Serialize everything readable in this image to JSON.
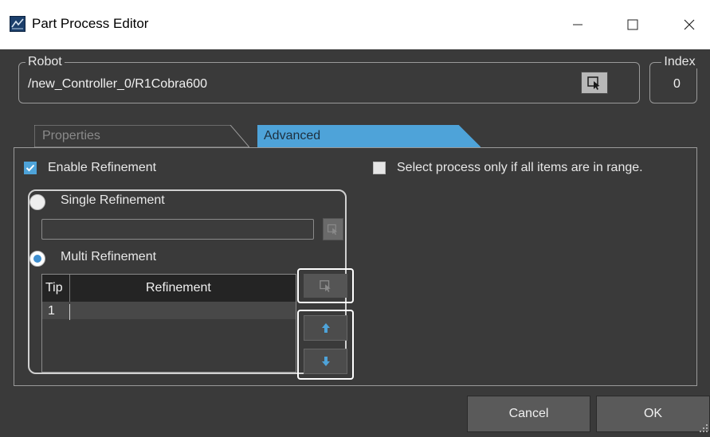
{
  "window": {
    "title": "Part Process Editor",
    "icon": "app-icon",
    "controls": [
      "minimize-icon",
      "maximize-icon",
      "close-icon"
    ]
  },
  "robot": {
    "label": "Robot",
    "value": "/new_Controller_0/R1Cobra600",
    "pick_icon": "pointer-select-icon"
  },
  "index": {
    "label": "Index",
    "value": "0"
  },
  "tabs": [
    {
      "label": "Properties",
      "active": false
    },
    {
      "label": "Advanced",
      "active": true
    }
  ],
  "advanced": {
    "enable_refinement_label": "Enable Refinement",
    "enable_refinement_checked": true,
    "select_in_range_label": "Select process only if all items are in range.",
    "select_in_range_checked": false,
    "single_refinement_label": "Single Refinement",
    "single_refinement_selected": false,
    "single_refinement_value": "",
    "multi_refinement_label": "Multi Refinement",
    "multi_refinement_selected": true,
    "table": {
      "columns": [
        "Tip",
        "Refinement"
      ],
      "rows": [
        {
          "tip": "1",
          "refinement": ""
        }
      ]
    }
  },
  "buttons": {
    "cancel": "Cancel",
    "ok": "OK"
  },
  "colors": {
    "background": "#3a3a3a",
    "accent": "#4ea3d9",
    "titlebar": "#ffffff"
  }
}
